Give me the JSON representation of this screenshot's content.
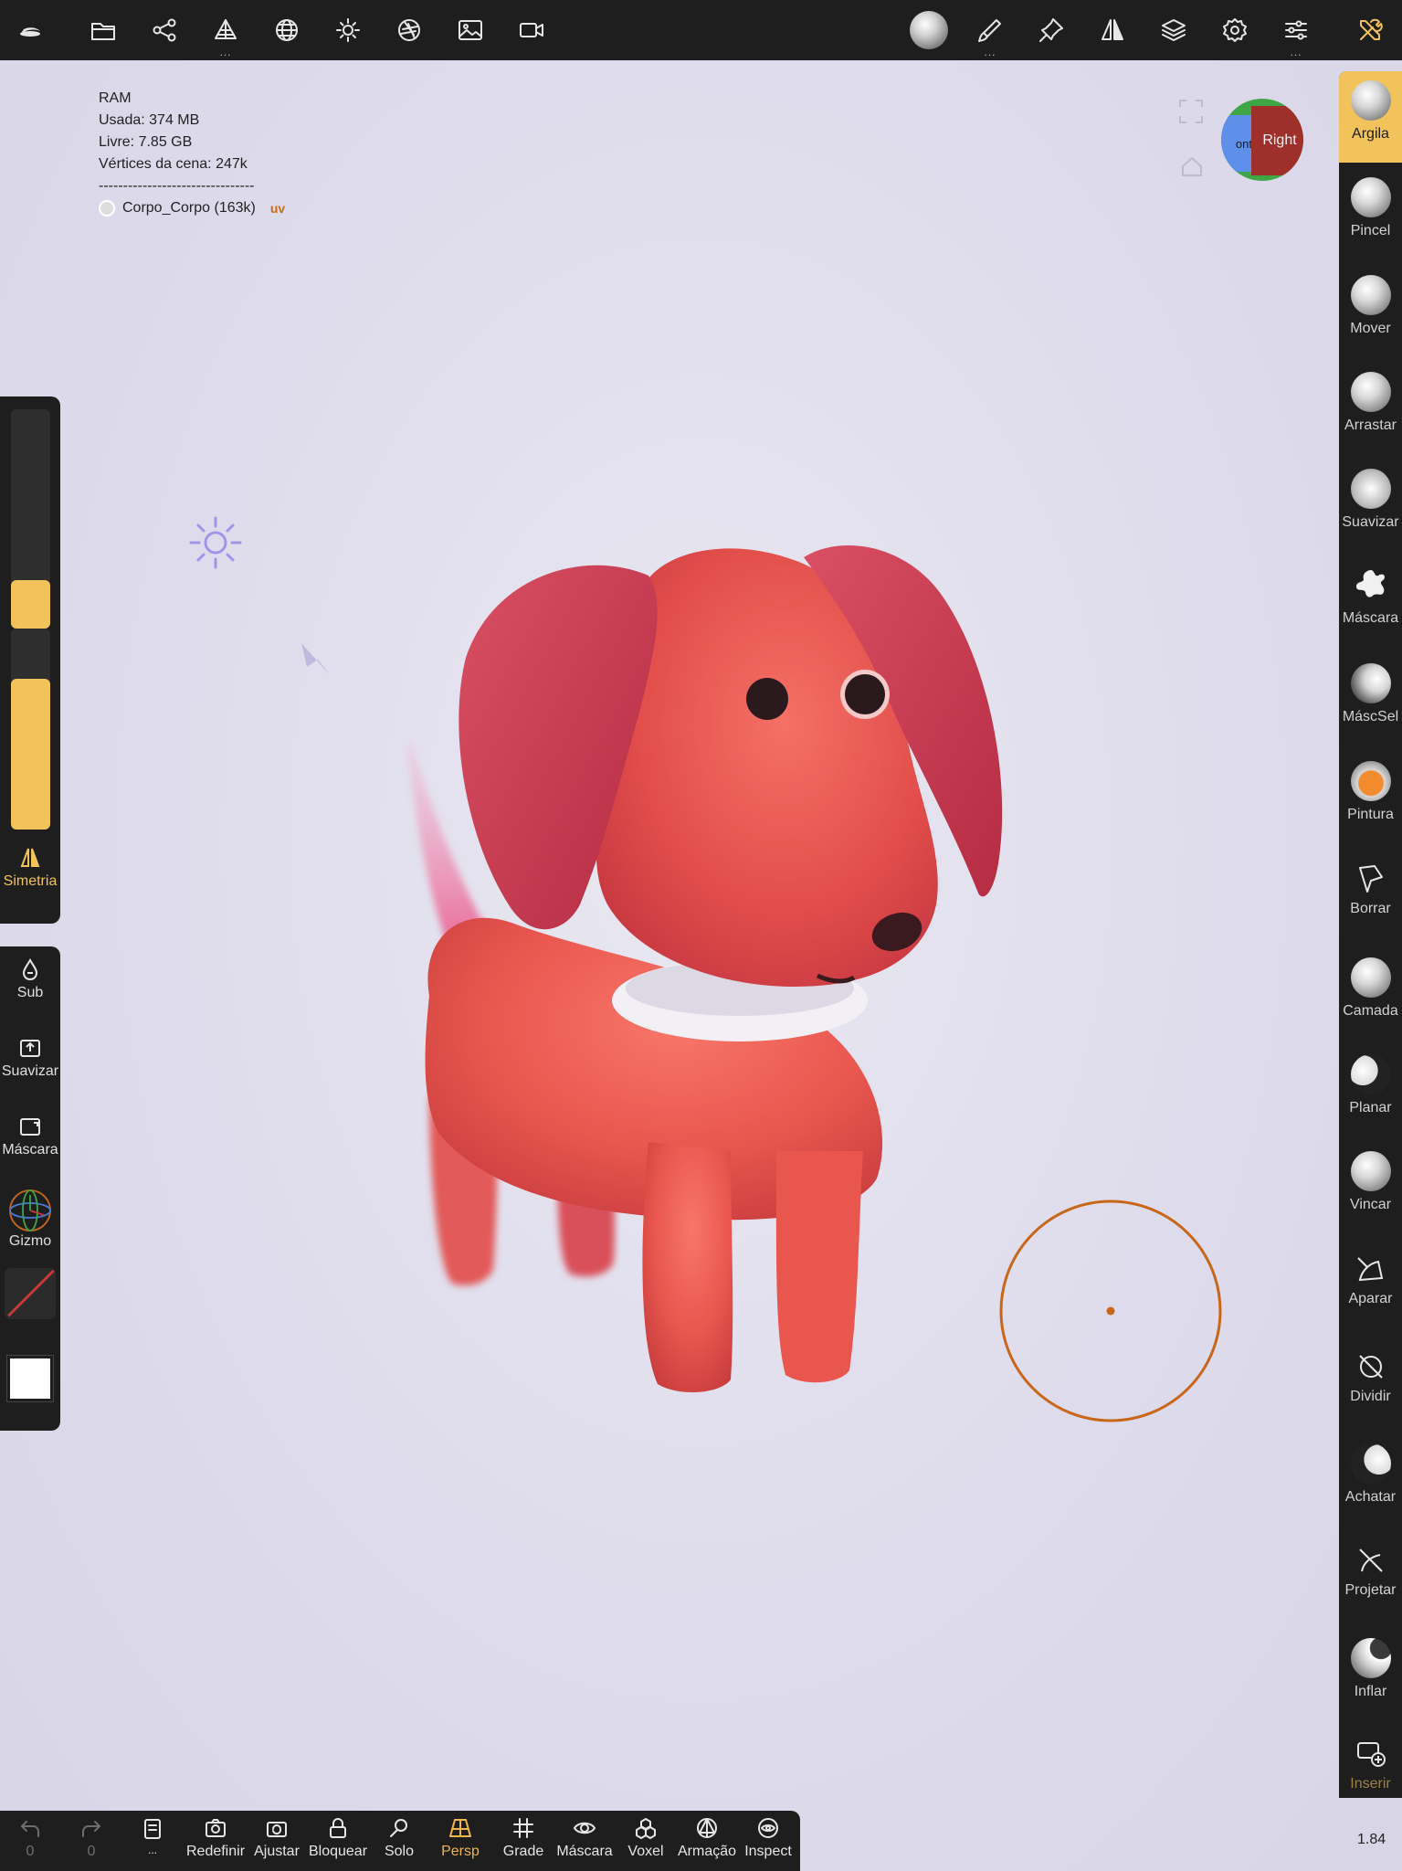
{
  "topbar": {
    "items": [
      {
        "name": "app-logo-icon"
      },
      {
        "name": "folder-icon"
      },
      {
        "name": "scene-graph-icon"
      },
      {
        "name": "primitives-icon",
        "more": "..."
      },
      {
        "name": "sphere-grid-icon"
      },
      {
        "name": "light-icon"
      },
      {
        "name": "aperture-icon"
      },
      {
        "name": "image-icon"
      },
      {
        "name": "video-icon"
      }
    ],
    "right_items": [
      {
        "name": "material-preview-icon"
      },
      {
        "name": "brush-icon",
        "more": "..."
      },
      {
        "name": "pin-icon"
      },
      {
        "name": "symmetry-icon"
      },
      {
        "name": "layers-icon"
      },
      {
        "name": "settings-gear-icon"
      },
      {
        "name": "sliders-icon",
        "more": "..."
      },
      {
        "name": "tools-icon"
      }
    ]
  },
  "stats": {
    "ram": "RAM",
    "used": "Usada: 374 MB",
    "free": "Livre: 7.85 GB",
    "vertices": "Vértices da cena: 247k",
    "separator": "--------------------------------",
    "mesh": "Corpo_Corpo (163k)",
    "uv": "uv"
  },
  "gizmo": {
    "front": "ont",
    "right": "Right"
  },
  "tools": [
    {
      "label": "Argila",
      "active": true
    },
    {
      "label": "Pincel"
    },
    {
      "label": "Mover"
    },
    {
      "label": "Arrastar"
    },
    {
      "label": "Suavizar"
    },
    {
      "label": "Máscara"
    },
    {
      "label": "MáscSel"
    },
    {
      "label": "Pintura"
    },
    {
      "label": "Borrar"
    },
    {
      "label": "Camada"
    },
    {
      "label": "Planar"
    },
    {
      "label": "Vincar"
    },
    {
      "label": "Aparar"
    },
    {
      "label": "Dividir"
    },
    {
      "label": "Achatar"
    },
    {
      "label": "Projetar"
    },
    {
      "label": "Inflar"
    },
    {
      "label": "Inserir"
    }
  ],
  "left_panel": {
    "radius_fraction": 0.22,
    "intensity_fraction": 0.75,
    "symmetry": "Simetria",
    "sub": "Sub",
    "smooth": "Suavizar",
    "mask": "Máscara",
    "gizmo": "Gizmo"
  },
  "bottombar": {
    "undo_count": "0",
    "redo_count": "0",
    "more": "...",
    "items": [
      {
        "label": "Redefinir",
        "icon": "camera-reset-icon"
      },
      {
        "label": "Ajustar",
        "icon": "fit-icon"
      },
      {
        "label": "Bloquear",
        "icon": "lock-icon"
      },
      {
        "label": "Solo",
        "icon": "search-icon"
      },
      {
        "label": "Persp",
        "icon": "perspective-icon",
        "active": true
      },
      {
        "label": "Grade",
        "icon": "grid-icon"
      },
      {
        "label": "Máscara",
        "icon": "eye-icon"
      },
      {
        "label": "Voxel",
        "icon": "voxel-icon"
      },
      {
        "label": "Armação",
        "icon": "wireframe-icon"
      },
      {
        "label": "Inspect",
        "icon": "inspect-icon"
      }
    ]
  },
  "fps": "1.84",
  "colors": {
    "accent": "#f2c35a",
    "brush_cursor": "#c8661a",
    "panel": "#1e1e1e",
    "model": "#e9574f"
  }
}
